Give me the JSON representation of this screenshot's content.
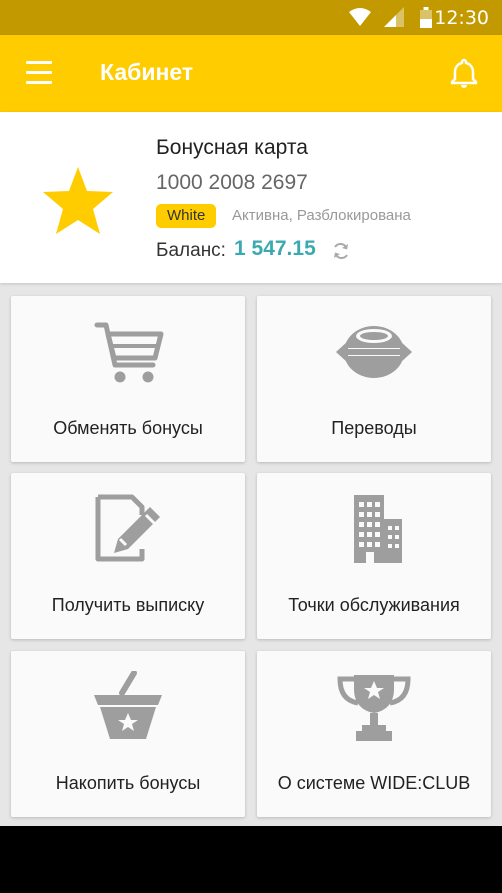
{
  "status_bar": {
    "time": "12:30"
  },
  "toolbar": {
    "title": "Кабинет"
  },
  "card": {
    "title": "Бонусная карта",
    "number": "1000 2008 2697",
    "level_badge": "White",
    "status": "Активна, Разблокирована",
    "balance_label": "Баланс:",
    "balance_value": "1 547.15"
  },
  "tiles": [
    {
      "label": "Обменять бонусы",
      "icon": "cart-icon"
    },
    {
      "label": "Переводы",
      "icon": "transfer-icon"
    },
    {
      "label": "Получить выписку",
      "icon": "edit-document-icon"
    },
    {
      "label": "Точки обслуживания",
      "icon": "building-icon"
    },
    {
      "label": "Накопить бонусы",
      "icon": "basket-icon"
    },
    {
      "label": "О системе WIDE:CLUB",
      "icon": "trophy-icon"
    }
  ],
  "colors": {
    "accent": "#ffcc00",
    "status_bar": "#c29a00",
    "balance": "#3aa9b0",
    "icon": "#9e9e9e"
  }
}
